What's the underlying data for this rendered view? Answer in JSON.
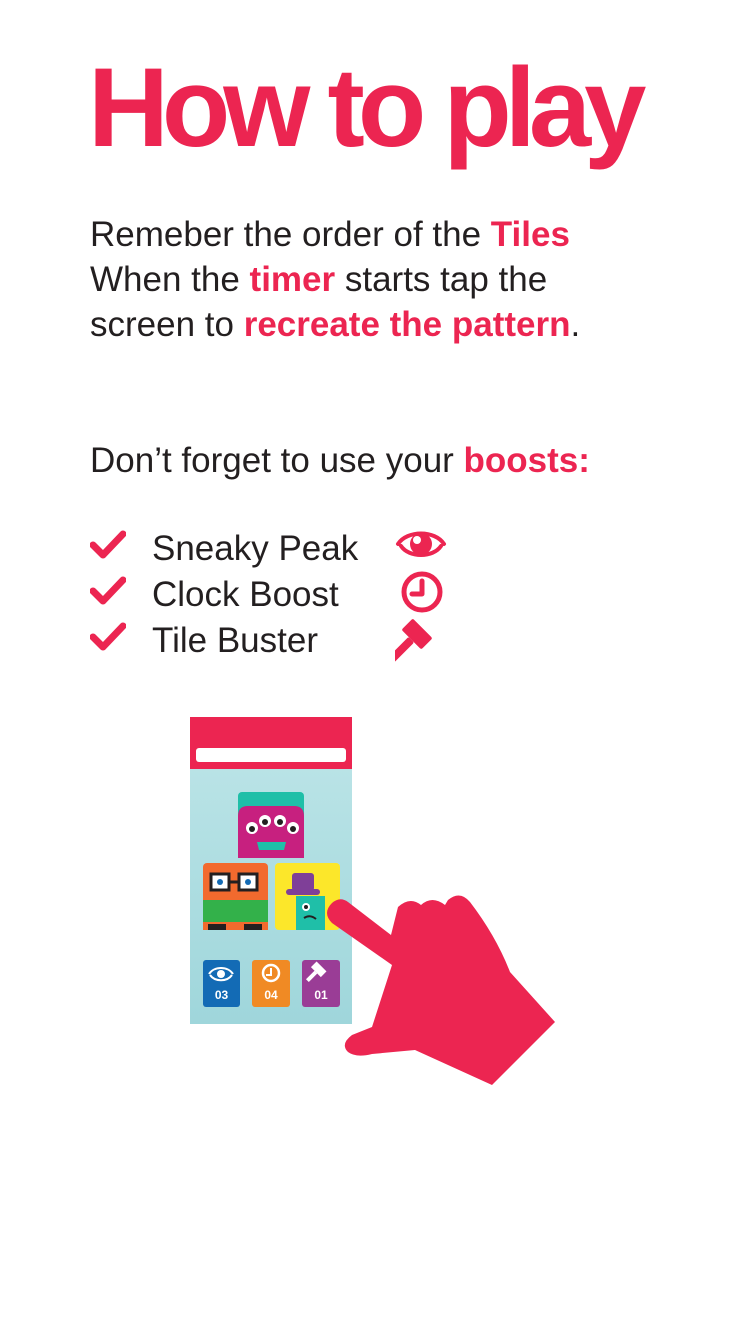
{
  "title": "How to play",
  "instructions": {
    "line1_a": "Remeber the order of the ",
    "line1_hl": "Tiles",
    "line2_a": "When the ",
    "line2_hl": "timer",
    "line2_b": " starts tap the",
    "line3_a": "screen to ",
    "line3_hl": "recreate the pattern",
    "line3_b": "."
  },
  "boosts_intro": {
    "text": "Don’t forget to use your ",
    "hl": "boosts:"
  },
  "boosts": [
    {
      "name": "Sneaky Peak",
      "icon": "eye-icon"
    },
    {
      "name": "Clock Boost",
      "icon": "clock-icon"
    },
    {
      "name": "Tile Buster",
      "icon": "hammer-icon"
    }
  ],
  "phone_boost_counts": [
    "03",
    "04",
    "01"
  ],
  "colors": {
    "accent": "#ec2551",
    "text": "#231f20",
    "phone_screen": "#a9dde1",
    "monster_teal": "#1fbfa8",
    "monster_magenta": "#c7207f",
    "monster_orange": "#f26a2e",
    "monster_green": "#33b14a",
    "monster_yellow": "#fce72a",
    "boost_blue": "#136bb5",
    "boost_orange": "#f08a24",
    "boost_purple": "#9a3d96"
  }
}
